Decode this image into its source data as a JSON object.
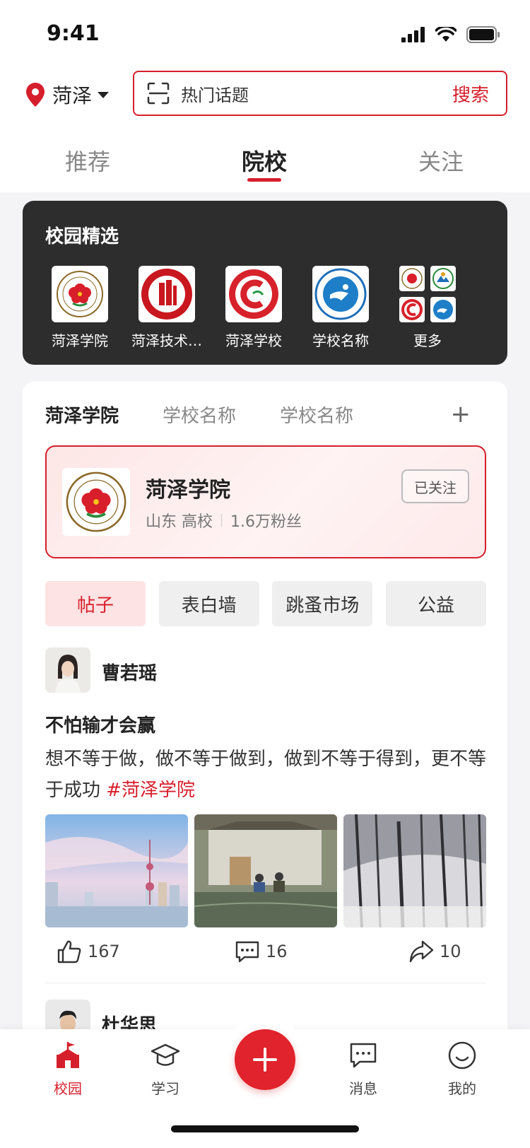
{
  "status": {
    "time": "9:41"
  },
  "header": {
    "location": "菏泽",
    "search_placeholder": "热门话题",
    "search_button": "搜索"
  },
  "tabs": [
    {
      "label": "推荐",
      "active": false
    },
    {
      "label": "院校",
      "active": true
    },
    {
      "label": "关注",
      "active": false
    }
  ],
  "featured": {
    "title": "校园精选",
    "schools": [
      {
        "name": "菏泽学院"
      },
      {
        "name": "菏泽技术…"
      },
      {
        "name": "菏泽学校"
      },
      {
        "name": "学校名称"
      },
      {
        "name": "更多"
      }
    ]
  },
  "school_tabs": [
    "菏泽学院",
    "学校名称",
    "学校名称"
  ],
  "school_tab_add": "+",
  "school_card": {
    "name": "菏泽学院",
    "region": "山东 高校",
    "fans": "1.6万粉丝",
    "follow_label": "已关注"
  },
  "categories": [
    {
      "label": "帖子",
      "active": true
    },
    {
      "label": "表白墙",
      "active": false
    },
    {
      "label": "跳蚤市场",
      "active": false
    },
    {
      "label": "公益",
      "active": false
    }
  ],
  "post": {
    "author": "曹若瑶",
    "title": "不怕输才会赢",
    "text": "想不等于做，做不等于做到，做到不等于得到，更不等于成功 ",
    "tag": "#菏泽学院",
    "likes": "167",
    "comments": "16",
    "shares": "10"
  },
  "post2": {
    "author": "杜华思"
  },
  "nav": [
    {
      "label": "校园",
      "active": true
    },
    {
      "label": "学习",
      "active": false
    },
    {
      "label": "消息",
      "active": false
    },
    {
      "label": "我的",
      "active": false
    }
  ],
  "colors": {
    "accent": "#d61f2c",
    "dark_panel": "#2d2d2d"
  }
}
